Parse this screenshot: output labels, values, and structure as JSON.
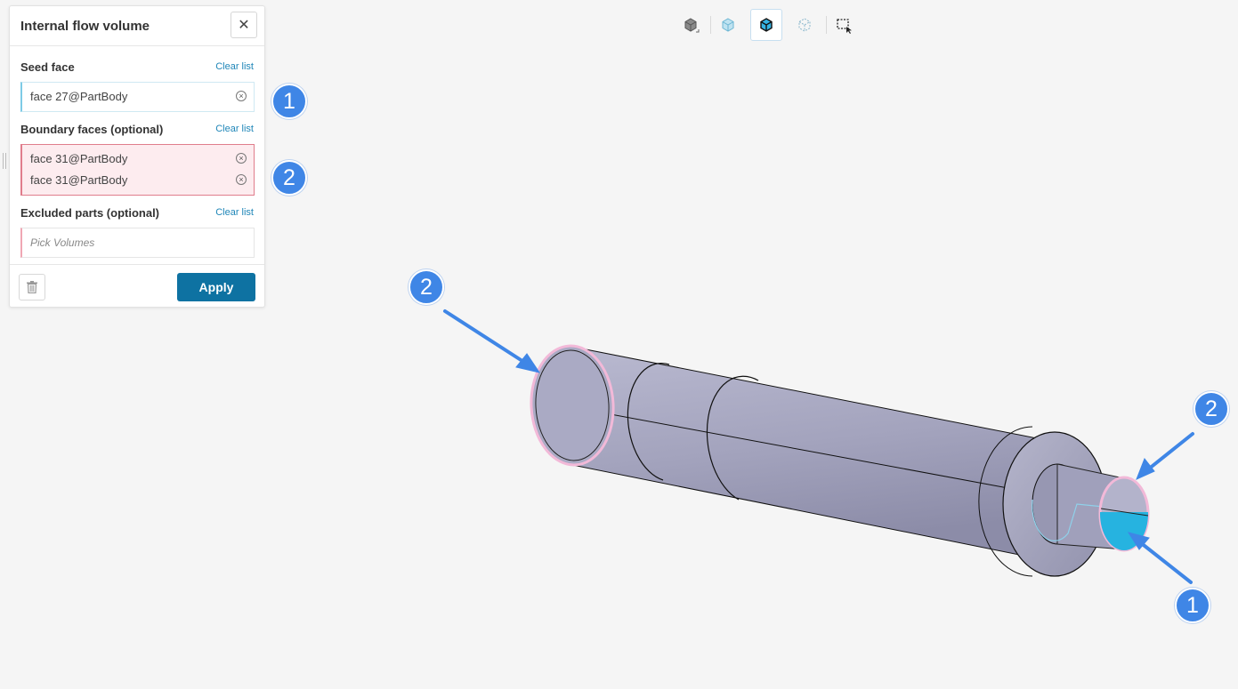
{
  "panel": {
    "title": "Internal flow volume",
    "close_glyph": "✕",
    "seed_face": {
      "label": "Seed face",
      "clear": "Clear list",
      "items": [
        "face 27@PartBody"
      ]
    },
    "boundary_faces": {
      "label": "Boundary faces (optional)",
      "clear": "Clear list",
      "items": [
        "face 31@PartBody",
        "face 31@PartBody"
      ]
    },
    "excluded_parts": {
      "label": "Excluded parts (optional)",
      "clear": "Clear list",
      "placeholder": "Pick Volumes"
    },
    "apply_label": "Apply"
  },
  "callouts": {
    "seed_panel": "1",
    "boundary_panel": "2",
    "left_end": "2",
    "right_end_top": "2",
    "right_end_bottom": "1"
  },
  "toolbar": {
    "buttons": [
      {
        "name": "solid-view-icon",
        "active": false
      },
      {
        "name": "transparent-view-icon",
        "active": false
      },
      {
        "name": "edge-view-icon",
        "active": true
      },
      {
        "name": "wireframe-view-icon",
        "active": false
      },
      {
        "name": "box-select-icon",
        "active": false
      }
    ]
  },
  "colors": {
    "accent": "#0e72a2",
    "link": "#1f86b8",
    "badge": "#3f86e6",
    "seed_face": "#26b3e0",
    "boundary_highlight": "#f2b9d8",
    "part_body": "#a7a7c2",
    "error_bg": "#fdecef",
    "error_border": "#e07d8c"
  }
}
